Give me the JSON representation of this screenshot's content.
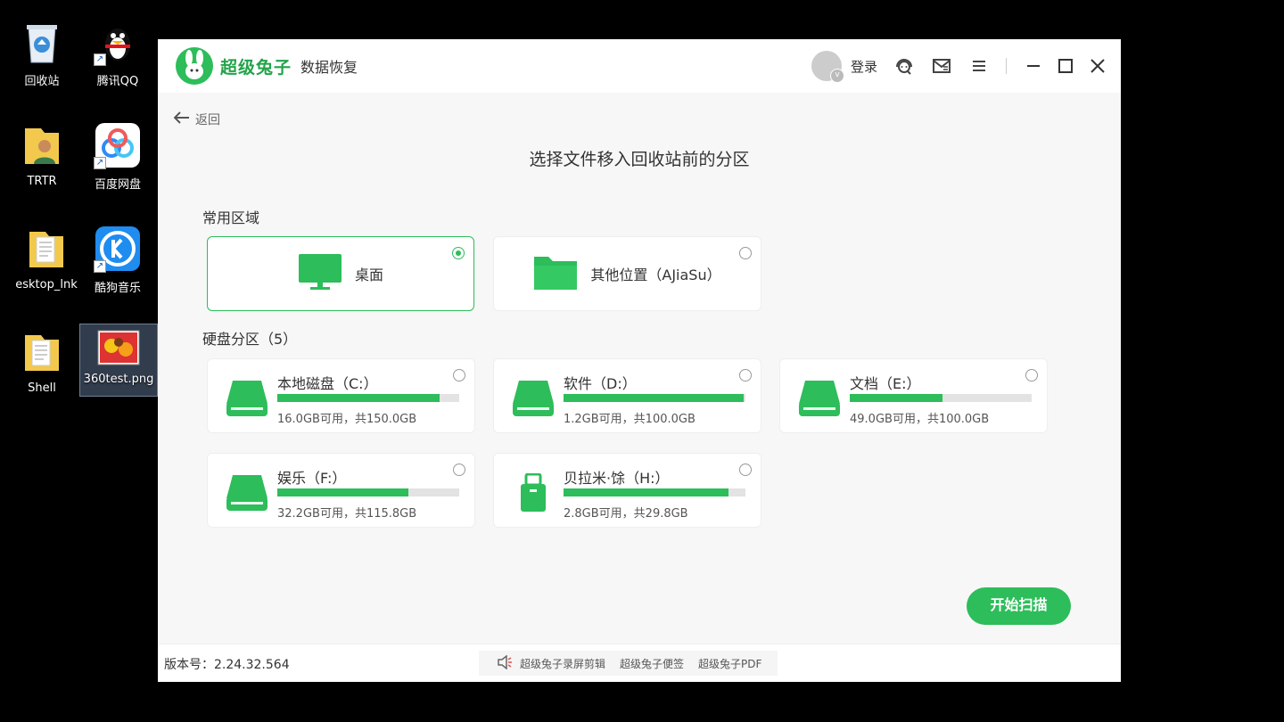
{
  "desktop": {
    "icons": [
      {
        "label": "回收站",
        "icon": "recycle-bin-icon"
      },
      {
        "label": "腾讯QQ",
        "icon": "qq-penguin-icon"
      },
      {
        "label": "TRTR",
        "icon": "user-folder-icon"
      },
      {
        "label": "百度网盘",
        "icon": "baidu-netdisk-icon"
      },
      {
        "label": "esktop_lnk",
        "icon": "document-folder-icon"
      },
      {
        "label": "酷狗音乐",
        "icon": "kugou-music-icon"
      },
      {
        "label": "Shell",
        "icon": "document-folder-icon"
      },
      {
        "label": "360test.png",
        "icon": "image-file-icon"
      }
    ]
  },
  "app": {
    "brand_name": "超级兔子",
    "brand_sub": "数据恢复",
    "login_label": "登录",
    "back_label": "返回",
    "page_title": "选择文件移入回收站前的分区",
    "common_section_label": "常用区域",
    "locations": [
      {
        "label": "桌面",
        "icon": "monitor-icon",
        "selected": true
      },
      {
        "label": "其他位置（AJiaSu）",
        "icon": "folder-icon",
        "selected": false
      }
    ],
    "drives_section_label": "硬盘分区（5）",
    "drives": [
      {
        "name": "本地磁盘（C:）",
        "info": "16.0GB可用，共150.0GB",
        "used_fraction": 0.893,
        "icon": "hard-drive-icon"
      },
      {
        "name": "软件（D:）",
        "info": "1.2GB可用，共100.0GB",
        "used_fraction": 0.988,
        "icon": "hard-drive-icon"
      },
      {
        "name": "文档（E:）",
        "info": "49.0GB可用，共100.0GB",
        "used_fraction": 0.51,
        "icon": "hard-drive-icon"
      },
      {
        "name": "娱乐（F:）",
        "info": "32.2GB可用，共115.8GB",
        "used_fraction": 0.722,
        "icon": "hard-drive-icon"
      },
      {
        "name": "贝拉米·馀（H:）",
        "info": "2.8GB可用，共29.8GB",
        "used_fraction": 0.906,
        "icon": "usb-drive-icon"
      }
    ],
    "start_button": "开始扫描",
    "version": "版本号：2.24.32.564",
    "footer_links": [
      "超级兔子录屏剪辑",
      "超级兔子便签",
      "超级兔子PDF"
    ],
    "accent_color": "#2dbd5a"
  }
}
